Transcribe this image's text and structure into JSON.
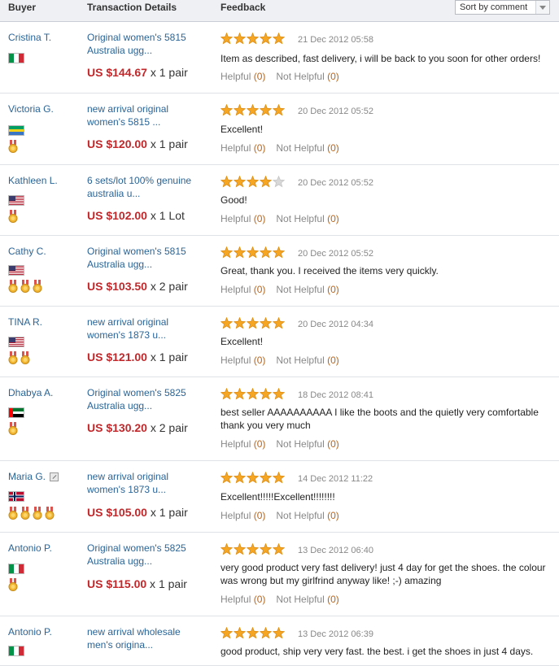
{
  "header": {
    "buyer": "Buyer",
    "transaction": "Transaction Details",
    "feedback": "Feedback",
    "sort_label": "Sort by comment"
  },
  "helpful_label": "Helpful",
  "not_helpful_label": "Not Helpful",
  "rows": [
    {
      "name": "Cristina T.",
      "flag": "italy",
      "medals": 0,
      "title": "Original women's 5815 Australia ugg...",
      "price": "US $144.67",
      "qty": " x 1 pair",
      "stars": 5,
      "date": "21 Dec 2012 05:58",
      "comment": "Item as described, fast delivery, i will be back to you soon for other orders!",
      "helpful": "(0)",
      "not_helpful": "(0)"
    },
    {
      "name": "Victoria G.",
      "flag": "gabon",
      "medals": 1,
      "title": "new arrival original women's 5815 ...",
      "price": "US $120.00",
      "qty": " x 1 pair",
      "stars": 5,
      "date": "20 Dec 2012 05:52",
      "comment": "Excellent!",
      "helpful": "(0)",
      "not_helpful": "(0)"
    },
    {
      "name": "Kathleen L.",
      "flag": "usa",
      "medals": 1,
      "title": "6 sets/lot 100% genuine australia u...",
      "price": "US $102.00",
      "qty": " x 1 Lot",
      "stars": 4,
      "date": "20 Dec 2012 05:52",
      "comment": "Good!",
      "helpful": "(0)",
      "not_helpful": "(0)"
    },
    {
      "name": "Cathy C.",
      "flag": "usa",
      "medals": 3,
      "title": "Original women's 5815 Australia ugg...",
      "price": "US $103.50",
      "qty": " x 2 pair",
      "stars": 5,
      "date": "20 Dec 2012 05:52",
      "comment": "Great, thank you. I received the items very quickly.",
      "helpful": "(0)",
      "not_helpful": "(0)"
    },
    {
      "name": "TINA R.",
      "flag": "usa",
      "medals": 2,
      "title": "new arrival original women's 1873 u...",
      "price": "US $121.00",
      "qty": " x 1 pair",
      "stars": 5,
      "date": "20 Dec 2012 04:34",
      "comment": "Excellent!",
      "helpful": "(0)",
      "not_helpful": "(0)"
    },
    {
      "name": "Dhabya A.",
      "flag": "uae",
      "medals": 1,
      "title": "Original women's 5825 Australia ugg...",
      "price": "US $130.20",
      "qty": " x 2 pair",
      "stars": 5,
      "date": "18 Dec 2012 08:41",
      "comment": "best seller AAAAAAAAAA I like the boots and the quietly very comfortable thank you very much",
      "helpful": "(0)",
      "not_helpful": "(0)"
    },
    {
      "name": "Maria G.",
      "flag": "norway",
      "medals": 4,
      "edit": true,
      "title": "new arrival original women's 1873 u...",
      "price": "US $105.00",
      "qty": " x 1 pair",
      "stars": 5,
      "date": "14 Dec 2012 11:22",
      "comment": "Excellent!!!!!Excellent!!!!!!!!",
      "helpful": "(0)",
      "not_helpful": "(0)"
    },
    {
      "name": "Antonio P.",
      "flag": "italy",
      "medals": 1,
      "title": "Original women's 5825 Australia ugg...",
      "price": "US $115.00",
      "qty": " x 1 pair",
      "stars": 5,
      "date": "13 Dec 2012 06:40",
      "comment": "very good product very fast delivery! just 4 day for get the shoes. the colour was wrong but my girlfrind anyway like! ;-) amazing",
      "helpful": "(0)",
      "not_helpful": "(0)"
    },
    {
      "name": "Antonio P.",
      "flag": "italy",
      "medals": 0,
      "title": "new arrival wholesale men's origina...",
      "price": "",
      "qty": "",
      "stars": 5,
      "date": "13 Dec 2012 06:39",
      "comment": "good product, ship very very fast. the best. i get the shoes in just 4 days.",
      "helpful": "",
      "not_helpful": ""
    }
  ],
  "colors": {
    "link": "#2a6496",
    "price": "#c0282b",
    "star": "#f5a623",
    "helpful_count": "#b5651d"
  }
}
